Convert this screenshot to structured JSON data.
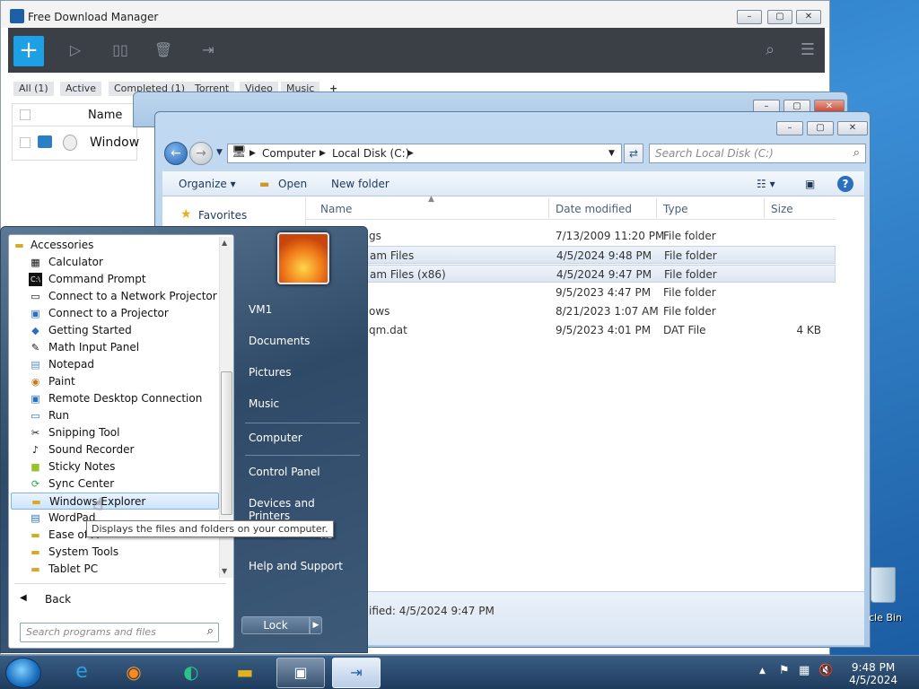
{
  "fdm": {
    "title": "Free Download Manager",
    "add_label": "+",
    "filters": [
      "All (1)",
      "Active",
      "Completed (1)",
      "Torrent",
      "Video",
      "Music",
      "+"
    ],
    "column_name": "Name",
    "row_name": "Window"
  },
  "explorer": {
    "address": {
      "root": "Computer",
      "folder": "Local Disk (C:)"
    },
    "search_placeholder": "Search Local Disk (C:)",
    "cmd": {
      "organize": "Organize",
      "open": "Open",
      "new_folder": "New folder"
    },
    "favorites": "Favorites",
    "columns": {
      "name": "Name",
      "date": "Date modified",
      "type": "Type",
      "size": "Size"
    },
    "files": [
      {
        "name": "gs",
        "date": "7/13/2009 11:20 PM",
        "type": "File folder",
        "size": ""
      },
      {
        "name": "am Files",
        "date": "4/5/2024 9:48 PM",
        "type": "File folder",
        "size": ""
      },
      {
        "name": "am Files (x86)",
        "date": "4/5/2024 9:47 PM",
        "type": "File folder",
        "size": ""
      },
      {
        "name": "",
        "date": "9/5/2023 4:47 PM",
        "type": "File folder",
        "size": ""
      },
      {
        "name": "ows",
        "date": "8/21/2023 1:07 AM",
        "type": "File folder",
        "size": ""
      },
      {
        "name": "qm.dat",
        "date": "9/5/2023 4:01 PM",
        "type": "DAT File",
        "size": "4 KB"
      }
    ],
    "details": "ified: 4/5/2024 9:47 PM"
  },
  "startmenu": {
    "programs": [
      {
        "label": "Accessories",
        "icon": "folder-icon"
      },
      {
        "label": "Calculator",
        "icon": "calculator-icon"
      },
      {
        "label": "Command Prompt",
        "icon": "cmd-icon"
      },
      {
        "label": "Connect to a Network Projector",
        "icon": "projector-icon"
      },
      {
        "label": "Connect to a Projector",
        "icon": "monitor-icon"
      },
      {
        "label": "Getting Started",
        "icon": "start-icon"
      },
      {
        "label": "Math Input Panel",
        "icon": "pen-icon"
      },
      {
        "label": "Notepad",
        "icon": "notepad-icon"
      },
      {
        "label": "Paint",
        "icon": "paint-icon"
      },
      {
        "label": "Remote Desktop Connection",
        "icon": "remote-icon"
      },
      {
        "label": "Run",
        "icon": "run-icon"
      },
      {
        "label": "Snipping Tool",
        "icon": "scissors-icon"
      },
      {
        "label": "Sound Recorder",
        "icon": "mic-icon"
      },
      {
        "label": "Sticky Notes",
        "icon": "note-icon"
      },
      {
        "label": "Sync Center",
        "icon": "sync-icon"
      },
      {
        "label": "Windows Explorer",
        "icon": "folder-icon"
      },
      {
        "label": "WordPad",
        "icon": "wordpad-icon"
      },
      {
        "label": "Ease of A",
        "icon": "folder-icon"
      },
      {
        "label": "System Tools",
        "icon": "folder-icon"
      },
      {
        "label": "Tablet PC",
        "icon": "folder-icon"
      }
    ],
    "back": "Back",
    "search_placeholder": "Search programs and files",
    "right": [
      "VM1",
      "Documents",
      "Pictures",
      "Music",
      "Computer",
      "Control Panel",
      "Devices and Printers",
      "ns",
      "Help and Support"
    ],
    "lock": "Lock"
  },
  "tooltip": "Displays the files and folders on your computer.",
  "recycle_label": "cle Bin",
  "taskbar": {
    "time": "9:48 PM",
    "date": "4/5/2024"
  }
}
